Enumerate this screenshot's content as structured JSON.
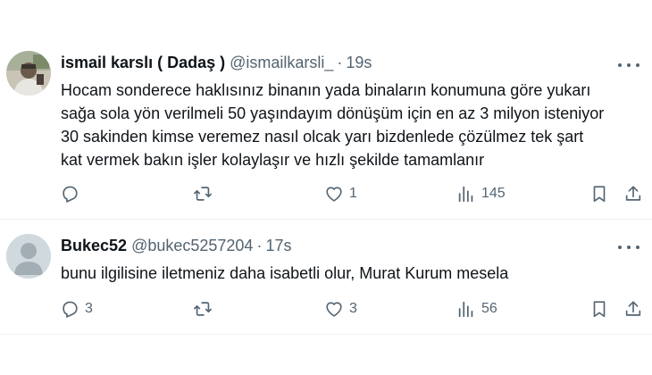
{
  "tweets": [
    {
      "name": "ismail karslı ( Dadaş )",
      "handle": "@ismailkarsli_",
      "separator": "·",
      "time": "19s",
      "text_lines": [
        "Hocam sonderece haklısınız binanın yada binaların konumuna göre yukarı",
        "sağa sola yön verilmeli 50 yaşındayım dönüşüm için en az 3 milyon isteniyor",
        "30 sakinden kimse veremez nasıl olcak yarı bizdenlede çözülmez tek şart",
        "kat vermek bakın işler kolaylaşır ve hızlı şekilde tamamlanır"
      ],
      "replies": "",
      "retweets": "",
      "likes": "1",
      "views": "145",
      "avatar": "photo-avatar"
    },
    {
      "name": "Bukec52",
      "handle": "@bukec5257204",
      "separator": "·",
      "time": "17s",
      "text_lines": [
        "bunu ilgilisine iletmeniz daha isabetli olur, Murat Kurum mesela"
      ],
      "replies": "3",
      "retweets": "",
      "likes": "3",
      "views": "56",
      "avatar": "default-avatar"
    }
  ],
  "icons": {
    "reply": "reply-icon",
    "retweet": "retweet-icon",
    "like": "heart-icon",
    "views": "views-icon",
    "bookmark": "bookmark-icon",
    "share": "share-icon",
    "more": "more-icon"
  },
  "colors": {
    "text": "#0f1419",
    "secondary": "#536471",
    "divider": "#eff3f4",
    "default_avatar_bg": "#cfd9de",
    "default_avatar_fg": "#a3adb4"
  }
}
